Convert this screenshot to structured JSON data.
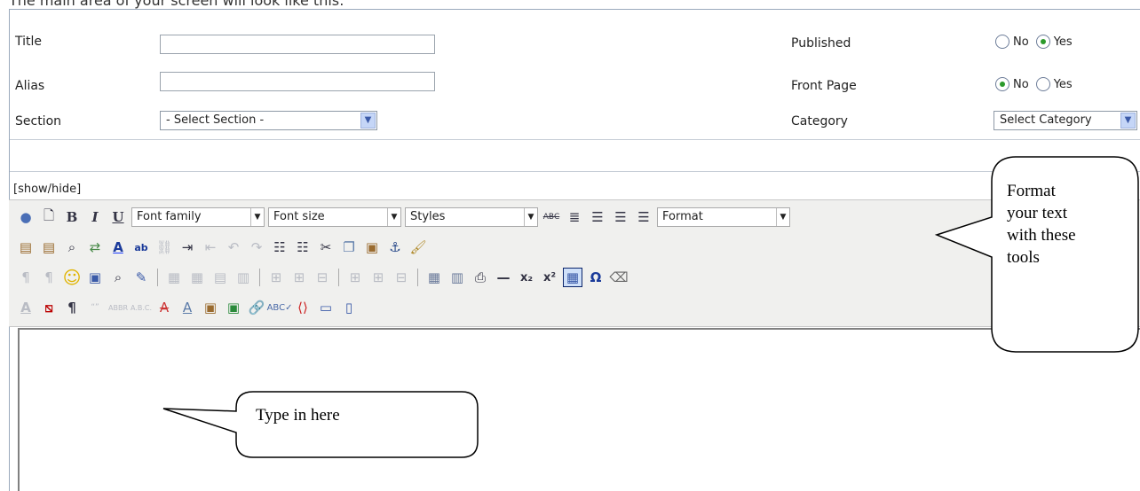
{
  "intro_text": "The main area of your screen will look like this:",
  "form": {
    "title_label": "Title",
    "alias_label": "Alias",
    "section_label": "Section",
    "section_value": "- Select Section -",
    "published_label": "Published",
    "published_no": "No",
    "published_yes": "Yes",
    "published_selected": "Yes",
    "frontpage_label": "Front Page",
    "frontpage_no": "No",
    "frontpage_yes": "Yes",
    "frontpage_selected": "No",
    "category_label": "Category",
    "category_value": "Select Category"
  },
  "editor": {
    "showhide": "[show/hide]",
    "font_family": "Font family",
    "font_size": "Font size",
    "styles": "Styles",
    "format": "Format"
  },
  "callouts": {
    "tools": [
      "Format",
      "your text",
      "with these",
      "tools"
    ],
    "type": "Type in here"
  }
}
